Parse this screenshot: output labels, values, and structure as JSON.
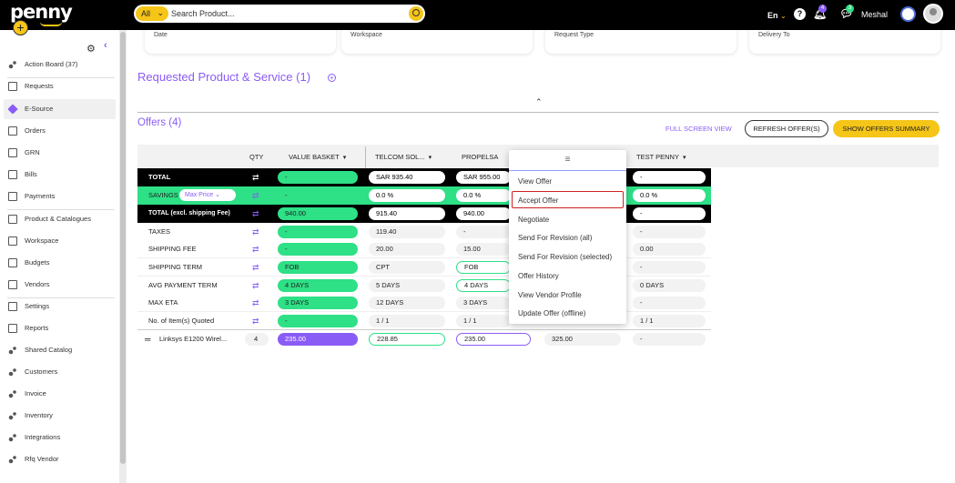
{
  "app": {
    "logo": "penny",
    "search_scope": "All",
    "search_placeholder": "Search Product...",
    "lang": "En",
    "notif_count": "4",
    "msg_count": "3",
    "username": "Meshal"
  },
  "sidebar": {
    "items": [
      {
        "label": "Action Board (37)",
        "icon": "dots-icon"
      },
      {
        "label": "Requests",
        "icon": "document-icon"
      },
      {
        "label": "E-Source",
        "icon": "tag-icon"
      },
      {
        "label": "Orders",
        "icon": "cart-icon"
      },
      {
        "label": "GRN",
        "icon": "list-icon"
      },
      {
        "label": "Bills",
        "icon": "bill-icon"
      },
      {
        "label": "Payments",
        "icon": "payment-icon"
      },
      {
        "label": "Product & Catalogues",
        "icon": "shapes-icon"
      },
      {
        "label": "Workspace",
        "icon": "briefcase-icon"
      },
      {
        "label": "Budgets",
        "icon": "budget-icon"
      },
      {
        "label": "Vendors",
        "icon": "vendor-icon"
      },
      {
        "label": "Settings",
        "icon": "gear-icon"
      },
      {
        "label": "Reports",
        "icon": "report-icon"
      },
      {
        "label": "Shared Catalog",
        "icon": "dots-icon"
      },
      {
        "label": "Customers",
        "icon": "dots-icon"
      },
      {
        "label": "Invoice",
        "icon": "dots-icon"
      },
      {
        "label": "Inventory",
        "icon": "dots-icon"
      },
      {
        "label": "Integrations",
        "icon": "dots-icon"
      },
      {
        "label": "Rfq Vendor",
        "icon": "dots-icon"
      }
    ]
  },
  "filters": [
    "Date",
    "Workspace",
    "Request Type",
    "Delivery To"
  ],
  "section": {
    "requested_title": "Requested Product & Service (1)",
    "offers_title": "Offers (4)",
    "full_screen": "FULL SCREEN VIEW",
    "refresh": "REFRESH OFFER(S)",
    "summary": "SHOW OFFERS SUMMARY"
  },
  "table": {
    "headers": {
      "qty": "QTY",
      "value_basket": "VALUE BASKET",
      "v1": "TELCOM SOL...",
      "v2": "PROPELSA",
      "v4": "TEST PENNY"
    },
    "rows": [
      {
        "label": "TOTAL",
        "vb": "-",
        "v1": "SAR 935.40",
        "v2": "SAR 955.00",
        "v4": "-"
      },
      {
        "label": "SAVINGS",
        "maxprice": "Max Price",
        "vb": "-",
        "v1": "0.0 %",
        "v2": "0.0 %",
        "v4": "0.0 %"
      },
      {
        "label": "TOTAL (excl. shipping Fee)",
        "vb": "940.00",
        "v1": "915.40",
        "v2": "940.00",
        "v4": "-"
      },
      {
        "label": "TAXES",
        "vb": "-",
        "v1": "119.40",
        "v2": "-",
        "v4": "-"
      },
      {
        "label": "SHIPPING FEE",
        "vb": "-",
        "v1": "20.00",
        "v2": "15.00",
        "v4": "0.00"
      },
      {
        "label": "SHIPPING TERM",
        "vb": "FOB",
        "v1": "CPT",
        "v2": "FOB",
        "v4": "-"
      },
      {
        "label": "AVG PAYMENT TERM",
        "vb": "4 DAYS",
        "v1": "5 DAYS",
        "v2": "4 DAYS",
        "v4": "0 DAYS"
      },
      {
        "label": "MAX ETA",
        "vb": "3 DAYS",
        "v1": "12 DAYS",
        "v2": "3 DAYS",
        "v4": "-"
      },
      {
        "label": "No. of Item(s) Quoted",
        "vb": "-",
        "v1": "1 / 1",
        "v2": "1 / 1",
        "v4": "1 / 1"
      }
    ],
    "product": {
      "name": "Linksys E1200 Wirel...",
      "qty": "4",
      "vb": "235.00",
      "v1": "228.85",
      "v2": "235.00",
      "v3": "325.00",
      "v4": "-"
    }
  },
  "menu": {
    "handle": "≡",
    "items": [
      "View Offer",
      "Accept Offer",
      "Negotiate",
      "Send For Revision (all)",
      "Send For Revision (selected)",
      "Offer History",
      "View Vendor Profile",
      "Update Offer (offline)"
    ]
  },
  "colors": {
    "accent": "#8a5cf6",
    "green": "#2ee086",
    "yellow": "#f5c518"
  }
}
